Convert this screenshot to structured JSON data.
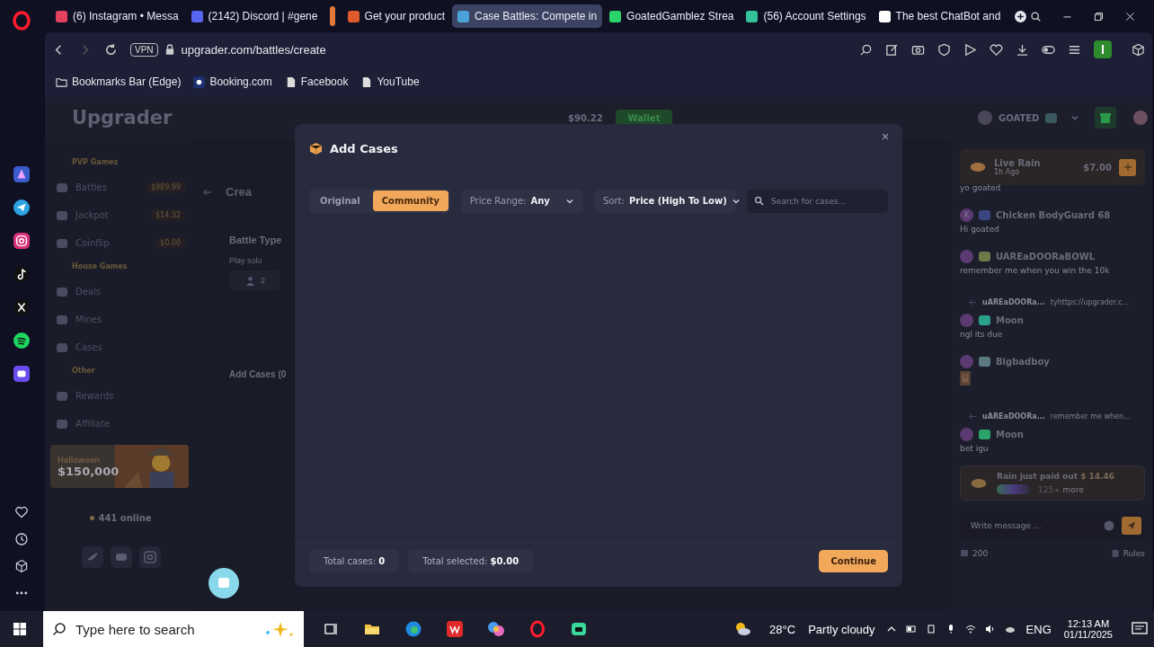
{
  "browser": {
    "tabs": [
      {
        "title": "(6) Instagram • Messa",
        "selected": false
      },
      {
        "title": "(2142) Discord | #gene",
        "selected": false
      },
      {
        "title": "Get your product",
        "selected": false
      },
      {
        "title": "Case Battles: Compete in",
        "selected": true
      },
      {
        "title": "GoatedGamblez Strea",
        "selected": false
      },
      {
        "title": "(56) Account Settings",
        "selected": false
      },
      {
        "title": "The best ChatBot and",
        "selected": false
      }
    ],
    "vpn": "VPN",
    "url": "upgrader.com/battles/create",
    "bookmarks": [
      "Bookmarks Bar (Edge)",
      "Booking.com",
      "Facebook",
      "YouTube"
    ]
  },
  "site": {
    "logo": "Upgrader",
    "balance": "$90.22",
    "wallet": "Wallet",
    "user": "GOATED",
    "sidebar": [
      {
        "heading": "PVP Games",
        "items": [
          {
            "label": "Battles",
            "amount": "$989.99"
          },
          {
            "label": "Jackpot",
            "amount": "$14.32"
          },
          {
            "label": "Coinflip",
            "amount": "$0.00"
          }
        ]
      },
      {
        "heading": "House Games",
        "items": [
          {
            "label": "Deals"
          },
          {
            "label": "Mines"
          },
          {
            "label": "Cases"
          }
        ]
      },
      {
        "heading": "Other",
        "items": [
          {
            "label": "Rewards"
          },
          {
            "label": "Affiliate"
          }
        ]
      }
    ],
    "promo": {
      "title": "Halloween",
      "amount": "$150,000"
    },
    "online": "441 online",
    "main": {
      "title": "Crea",
      "battle_type": "Battle Type",
      "mode": "Play solo",
      "players": "2",
      "add_cases": "Add Cases (0"
    },
    "chat": {
      "rain": {
        "title": "Live Rain",
        "time": "1h Ago",
        "amount": "$7.00"
      },
      "messages": [
        {
          "kind": "text",
          "text": "yo goated"
        },
        {
          "kind": "text",
          "user": "Chicken BodyGuard 68",
          "text": "Hi goated",
          "avatar": "K"
        },
        {
          "kind": "text",
          "user": "UAREaDOORaBOWL",
          "text": "remember me when you win the 10k"
        },
        {
          "kind": "text",
          "user": "Moon",
          "text": "ngl its due",
          "reply_user": "uAREaDOORa...",
          "reply_text": "tyhttps://upgrader.c..."
        },
        {
          "user": "Bigbadboy"
        },
        {
          "kind": "text",
          "user": "Moon",
          "text": "bet igu",
          "reply_user": "uAREaDOORa...",
          "reply_text": "remember me when..."
        }
      ],
      "payout": {
        "text": "Rain just paid out",
        "amount": "$ 14.46",
        "more": "125+",
        "more_label": "more"
      },
      "placeholder": "Write message ...",
      "online_count": "200",
      "rules": "Rules"
    }
  },
  "modal": {
    "title": "Add Cases",
    "tabs": [
      {
        "label": "Original",
        "selected": false
      },
      {
        "label": "Community",
        "selected": true
      }
    ],
    "price_label": "Price Range:",
    "price_value": "Any",
    "sort_label": "Sort:",
    "sort_value": "Price (High To Low)",
    "search_placeholder": "Search for cases...",
    "total_cases_label": "Total cases:",
    "total_cases": "0",
    "total_selected_label": "Total selected:",
    "total_selected": "$0.00",
    "continue": "Continue"
  },
  "taskbar": {
    "search_placeholder": "Type here to search",
    "temperature": "28°C",
    "weather": "Partly cloudy",
    "language": "ENG",
    "time": "12:13 AM",
    "date": "01/11/2025"
  }
}
